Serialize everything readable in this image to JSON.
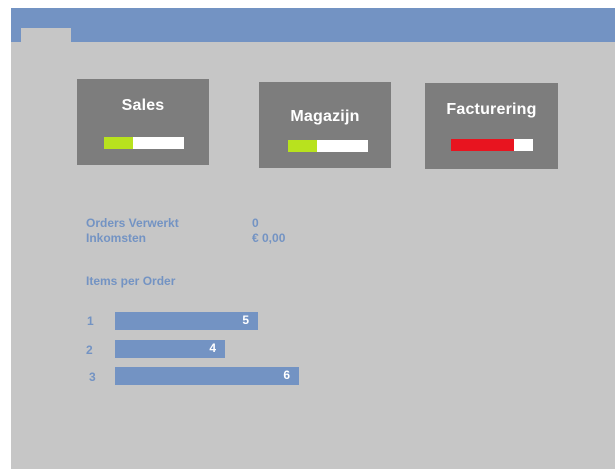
{
  "tiles": [
    {
      "title": "Sales",
      "fill": 0.36,
      "fill_color": "#b8e21e"
    },
    {
      "title": "Magazijn",
      "fill": 0.36,
      "fill_color": "#b8e21e"
    },
    {
      "title": "Facturering",
      "fill": 0.77,
      "fill_color": "#e8141f"
    }
  ],
  "stats": {
    "orders_label": "Orders Verwerkt",
    "orders_value": "0",
    "income_label": "Inkomsten",
    "income_value": "€ 0,00"
  },
  "items_per_order": {
    "title": "Items per Order",
    "rows": [
      {
        "index": "1",
        "value": "5"
      },
      {
        "index": "2",
        "value": "4"
      },
      {
        "index": "3",
        "value": "6"
      }
    ]
  },
  "colors": {
    "accent": "#7393c3",
    "panel_bg": "#c6c6c6",
    "tile_bg": "#7d7d7d"
  }
}
